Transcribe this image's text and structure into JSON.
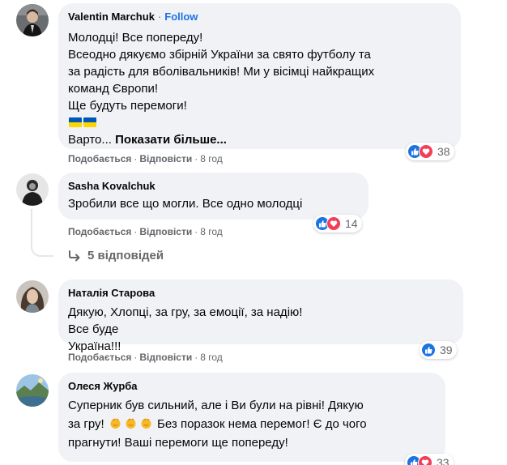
{
  "comments": [
    {
      "author": "Valentin Marchuk",
      "follow_label": "Follow",
      "lines": [
        "Молодці! Все попереду!",
        "Всеодно дякуємо збірній України за свято футболу та",
        "за радість для вболівальників! Ми у вісімці найкращих",
        "команд Європи!",
        "Ще будуть перемоги!",
        "Варто..."
      ],
      "more_label": "Показати більше...",
      "like_label": "Подобається",
      "reply_label": "Відповісти",
      "time": "8 год",
      "reaction_count": "38",
      "reactions": [
        "like-icon",
        "love-icon"
      ]
    },
    {
      "author": "Sasha Kovalchuk",
      "lines": [
        "Зробили все що могли. Все одно молодці"
      ],
      "like_label": "Подобається",
      "reply_label": "Відповісти",
      "time": "8 год",
      "reaction_count": "14",
      "reactions": [
        "like-icon",
        "love-icon"
      ],
      "replies_label": "5 відповідей"
    },
    {
      "author": "Наталія Старова",
      "lines": [
        "Дякую, Хлопці, за гру, за емоції, за надію!",
        "Все буде",
        "Україна!!!"
      ],
      "like_label": "Подобається",
      "reply_label": "Відповісти",
      "time": "8 год",
      "reaction_count": "39",
      "reactions": [
        "like-icon"
      ]
    },
    {
      "author": "Олеся Журба",
      "lines": [
        "Суперник був сильний, але і Ви були на рівні! Дякую",
        "за гру!",
        "Без поразок нема перемог! Є до чого",
        "прагнути! Ваші перемоги ще попереду!"
      ],
      "reaction_count": "33",
      "reactions": [
        "like-icon",
        "love-icon"
      ]
    }
  ],
  "separator": "·",
  "colors": {
    "bubble": "#f0f2f5",
    "secondary_text": "#65676b",
    "accent": "#1b74e4",
    "love": "#f33e58",
    "flag_blue": "#0057b7",
    "flag_yellow": "#ffd500"
  }
}
